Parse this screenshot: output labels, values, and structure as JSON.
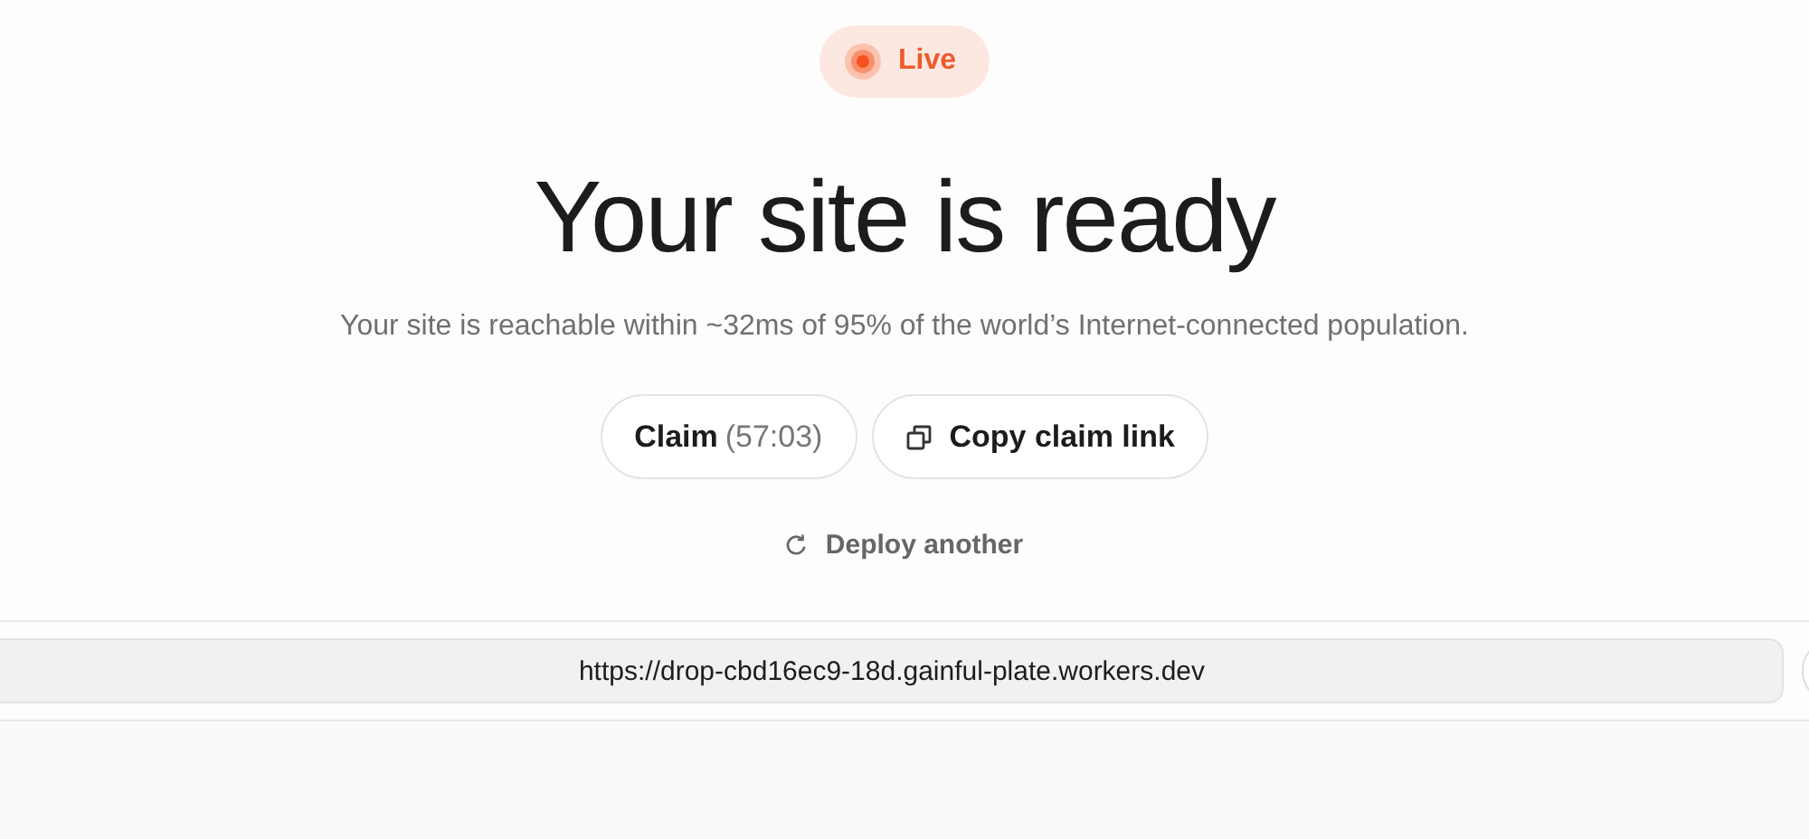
{
  "status_badge": {
    "label": "Live"
  },
  "title": "Your site is ready",
  "subtitle": "Your site is reachable within ~32ms of 95% of the world’s Internet-connected population.",
  "actions": [
    {
      "kind": "claim",
      "label": "Claim",
      "timer": "(57:03)"
    },
    {
      "kind": "copy",
      "label": "Copy claim link"
    }
  ],
  "deploy_link": "Deploy another",
  "url_bar": {
    "value": "https://drop-cbd16ec9-18d.gainful-plate.workers.dev"
  }
}
